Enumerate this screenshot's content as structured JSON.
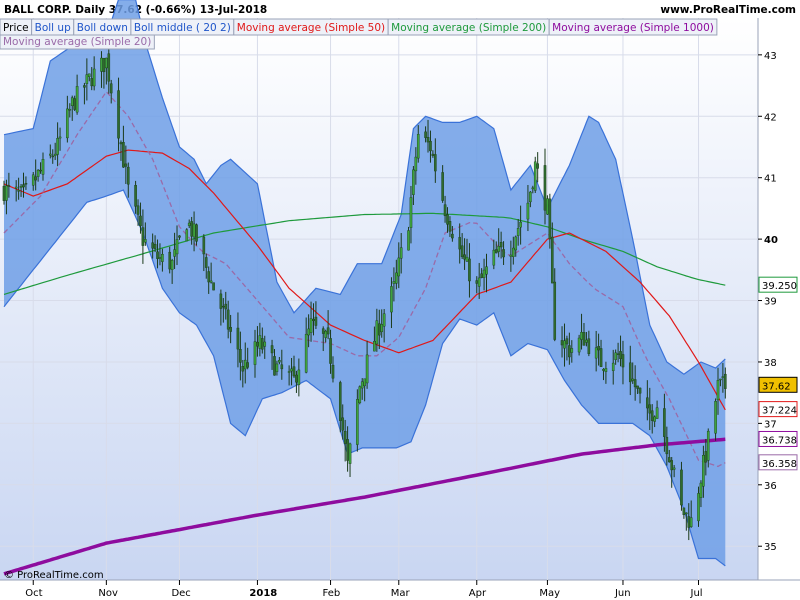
{
  "header": {
    "title": "BALL CORP.   Daily   37.62 (-0.66%)   13-Jul-2018",
    "website": "www.ProRealTime.com",
    "copyright": "© ProRealTime.com"
  },
  "colors": {
    "background": "#ffffff",
    "plot_background_top": "#ffffff",
    "plot_background_bottom": "#c9d6f2",
    "band_fill": "#6f9fe6",
    "band_line": "#3a72d8",
    "ma50": "#e01818",
    "ma200": "#1e9a3c",
    "ma1000": "#8e0c9e",
    "ma20": "#9a6aa8",
    "candle_up": "#3ea23e",
    "candle_down": "#2f6b2f",
    "wick": "#1a3a1a",
    "grid": "#d8dcea"
  },
  "chart_data": {
    "type": "candlestick",
    "symbol": "BALL CORP.",
    "interval": "Daily",
    "last_price": 37.62,
    "change_pct": "-0.66%",
    "date": "13-Jul-2018",
    "legend": [
      {
        "label": "Price",
        "color": "#000000"
      },
      {
        "label": "Boll up",
        "color": "#1f55c9"
      },
      {
        "label": "Boll down",
        "color": "#1f55c9"
      },
      {
        "label": "Boll middle ( 20 2)",
        "color": "#1f55c9"
      },
      {
        "label": "Moving average (Simple 50)",
        "color": "#e01818"
      },
      {
        "label": "Moving average (Simple 200)",
        "color": "#1e9a3c"
      },
      {
        "label": "Moving average (Simple 1000)",
        "color": "#8e0c9e"
      },
      {
        "label": "Moving average (Simple 20)",
        "color": "#9a6aa8"
      }
    ],
    "y_ticks": [
      35,
      36,
      37,
      38,
      39,
      40,
      41,
      42,
      43
    ],
    "y_ticks_bold": [
      40
    ],
    "ylim": [
      34.45,
      43.6
    ],
    "x_ticks": [
      {
        "label": "Oct",
        "bold": false
      },
      {
        "label": "Nov",
        "bold": false
      },
      {
        "label": "Dec",
        "bold": false
      },
      {
        "label": "2018",
        "bold": true
      },
      {
        "label": "Feb",
        "bold": false
      },
      {
        "label": "Mar",
        "bold": false
      },
      {
        "label": "Apr",
        "bold": false
      },
      {
        "label": "May",
        "bold": false
      },
      {
        "label": "Jun",
        "bold": false
      },
      {
        "label": "Jul",
        "bold": false
      }
    ],
    "x_tick_dates": [
      "2017-10-02",
      "2017-11-01",
      "2017-12-01",
      "2018-01-02",
      "2018-02-01",
      "2018-03-01",
      "2018-04-02",
      "2018-05-01",
      "2018-06-01",
      "2018-07-02"
    ],
    "start_date": "2017-09-20",
    "end_date": "2018-07-13",
    "x_axis_end_date": "2018-07-26",
    "price_labels": [
      {
        "text": "39.250",
        "value": 39.25,
        "color": "#1e9a3c",
        "fill": "#ffffff"
      },
      {
        "text": "37.62",
        "value": 37.62,
        "color": "#000000",
        "fill": "#f0c000"
      },
      {
        "text": "37.224",
        "value": 37.224,
        "color": "#e01818",
        "fill": "#ffffff"
      },
      {
        "text": "36.738",
        "value": 36.738,
        "color": "#8e0c9e",
        "fill": "#ffffff"
      },
      {
        "text": "36.358",
        "value": 36.358,
        "color": "#9a6aa8",
        "fill": "#ffffff"
      }
    ],
    "price_anchors": [
      [
        "2017-09-20",
        40.8
      ],
      [
        "2017-09-28",
        40.7
      ],
      [
        "2017-10-05",
        41.1
      ],
      [
        "2017-10-12",
        41.5
      ],
      [
        "2017-10-18",
        42.2
      ],
      [
        "2017-10-25",
        42.6
      ],
      [
        "2017-11-01",
        42.9
      ],
      [
        "2017-11-06",
        41.8
      ],
      [
        "2017-11-10",
        40.8
      ],
      [
        "2017-11-16",
        40.0
      ],
      [
        "2017-11-22",
        39.7
      ],
      [
        "2017-11-28",
        39.6
      ],
      [
        "2017-12-04",
        40.3
      ],
      [
        "2017-12-08",
        40.0
      ],
      [
        "2017-12-14",
        39.3
      ],
      [
        "2017-12-20",
        38.7
      ],
      [
        "2017-12-27",
        37.9
      ],
      [
        "2018-01-03",
        38.3
      ],
      [
        "2018-01-10",
        37.9
      ],
      [
        "2018-01-17",
        37.7
      ],
      [
        "2018-01-24",
        38.6
      ],
      [
        "2018-01-31",
        38.3
      ],
      [
        "2018-02-05",
        37.2
      ],
      [
        "2018-02-08",
        36.3
      ],
      [
        "2018-02-13",
        37.6
      ],
      [
        "2018-02-20",
        38.5
      ],
      [
        "2018-02-27",
        39.2
      ],
      [
        "2018-03-05",
        40.3
      ],
      [
        "2018-03-09",
        41.7
      ],
      [
        "2018-03-14",
        41.5
      ],
      [
        "2018-03-20",
        40.5
      ],
      [
        "2018-03-26",
        39.8
      ],
      [
        "2018-04-02",
        39.2
      ],
      [
        "2018-04-09",
        39.7
      ],
      [
        "2018-04-16",
        39.9
      ],
      [
        "2018-04-23",
        40.6
      ],
      [
        "2018-04-26",
        41.2
      ],
      [
        "2018-05-01",
        40.5
      ],
      [
        "2018-05-04",
        38.5
      ],
      [
        "2018-05-10",
        38.2
      ],
      [
        "2018-05-16",
        38.4
      ],
      [
        "2018-05-23",
        38.0
      ],
      [
        "2018-05-30",
        38.1
      ],
      [
        "2018-06-05",
        37.7
      ],
      [
        "2018-06-11",
        37.1
      ],
      [
        "2018-06-15",
        37.3
      ],
      [
        "2018-06-20",
        36.5
      ],
      [
        "2018-06-25",
        35.6
      ],
      [
        "2018-06-29",
        35.4
      ],
      [
        "2018-07-05",
        36.5
      ],
      [
        "2018-07-10",
        37.6
      ],
      [
        "2018-07-13",
        37.6
      ]
    ],
    "boll_up_anchors": [
      [
        "2017-09-20",
        41.7
      ],
      [
        "2017-10-02",
        41.8
      ],
      [
        "2017-10-09",
        42.9
      ],
      [
        "2017-10-20",
        43.2
      ],
      [
        "2017-11-01",
        43.3
      ],
      [
        "2017-11-06",
        43.9
      ],
      [
        "2017-11-13",
        43.9
      ],
      [
        "2017-11-17",
        43.2
      ],
      [
        "2017-11-24",
        42.3
      ],
      [
        "2017-12-01",
        41.5
      ],
      [
        "2017-12-07",
        41.3
      ],
      [
        "2017-12-12",
        40.9
      ],
      [
        "2017-12-18",
        41.2
      ],
      [
        "2017-12-22",
        41.3
      ],
      [
        "2018-01-02",
        40.9
      ],
      [
        "2018-01-10",
        39.3
      ],
      [
        "2018-01-17",
        38.8
      ],
      [
        "2018-01-26",
        39.2
      ],
      [
        "2018-02-05",
        39.1
      ],
      [
        "2018-02-12",
        39.6
      ],
      [
        "2018-02-22",
        39.6
      ],
      [
        "2018-03-02",
        40.4
      ],
      [
        "2018-03-07",
        41.8
      ],
      [
        "2018-03-12",
        42.0
      ],
      [
        "2018-03-19",
        41.9
      ],
      [
        "2018-03-26",
        41.9
      ],
      [
        "2018-04-02",
        42.0
      ],
      [
        "2018-04-09",
        41.8
      ],
      [
        "2018-04-16",
        40.8
      ],
      [
        "2018-04-24",
        41.2
      ],
      [
        "2018-05-01",
        40.5
      ],
      [
        "2018-05-10",
        41.2
      ],
      [
        "2018-05-18",
        42.0
      ],
      [
        "2018-05-22",
        41.9
      ],
      [
        "2018-05-29",
        41.3
      ],
      [
        "2018-06-05",
        40.0
      ],
      [
        "2018-06-12",
        38.6
      ],
      [
        "2018-06-19",
        38.0
      ],
      [
        "2018-06-26",
        37.8
      ],
      [
        "2018-07-03",
        38.0
      ],
      [
        "2018-07-09",
        37.9
      ],
      [
        "2018-07-13",
        38.05
      ]
    ],
    "boll_down_anchors": [
      [
        "2017-09-20",
        38.9
      ],
      [
        "2017-10-02",
        39.5
      ],
      [
        "2017-10-12",
        40.0
      ],
      [
        "2017-10-24",
        40.6
      ],
      [
        "2017-11-01",
        40.7
      ],
      [
        "2017-11-08",
        40.8
      ],
      [
        "2017-11-16",
        40.1
      ],
      [
        "2017-11-24",
        39.2
      ],
      [
        "2017-12-01",
        38.8
      ],
      [
        "2017-12-08",
        38.6
      ],
      [
        "2017-12-15",
        38.1
      ],
      [
        "2017-12-22",
        37.0
      ],
      [
        "2017-12-28",
        36.8
      ],
      [
        "2018-01-04",
        37.4
      ],
      [
        "2018-01-12",
        37.5
      ],
      [
        "2018-01-22",
        37.7
      ],
      [
        "2018-02-01",
        37.4
      ],
      [
        "2018-02-08",
        36.5
      ],
      [
        "2018-02-14",
        36.6
      ],
      [
        "2018-02-21",
        36.6
      ],
      [
        "2018-02-28",
        36.6
      ],
      [
        "2018-03-06",
        36.7
      ],
      [
        "2018-03-12",
        37.3
      ],
      [
        "2018-03-19",
        38.3
      ],
      [
        "2018-03-26",
        38.7
      ],
      [
        "2018-04-02",
        38.6
      ],
      [
        "2018-04-09",
        38.8
      ],
      [
        "2018-04-16",
        38.1
      ],
      [
        "2018-04-23",
        38.3
      ],
      [
        "2018-05-01",
        38.2
      ],
      [
        "2018-05-08",
        37.7
      ],
      [
        "2018-05-15",
        37.3
      ],
      [
        "2018-05-22",
        37.0
      ],
      [
        "2018-05-29",
        37.0
      ],
      [
        "2018-06-05",
        37.0
      ],
      [
        "2018-06-12",
        36.8
      ],
      [
        "2018-06-19",
        36.3
      ],
      [
        "2018-06-26",
        35.6
      ],
      [
        "2018-07-02",
        34.8
      ],
      [
        "2018-07-09",
        34.8
      ],
      [
        "2018-07-13",
        34.68
      ]
    ],
    "ma20_anchors": [
      [
        "2017-09-20",
        40.1
      ],
      [
        "2017-10-05",
        40.7
      ],
      [
        "2017-10-20",
        41.7
      ],
      [
        "2017-11-01",
        42.4
      ],
      [
        "2017-11-10",
        42.0
      ],
      [
        "2017-11-20",
        41.3
      ],
      [
        "2017-12-01",
        40.2
      ],
      [
        "2017-12-10",
        39.8
      ],
      [
        "2017-12-20",
        39.6
      ],
      [
        "2018-01-02",
        39.0
      ],
      [
        "2018-01-15",
        38.4
      ],
      [
        "2018-02-01",
        38.3
      ],
      [
        "2018-02-12",
        38.1
      ],
      [
        "2018-02-20",
        38.1
      ],
      [
        "2018-03-01",
        38.4
      ],
      [
        "2018-03-12",
        39.2
      ],
      [
        "2018-03-20",
        40.1
      ],
      [
        "2018-04-01",
        40.3
      ],
      [
        "2018-04-15",
        39.7
      ],
      [
        "2018-05-01",
        40.1
      ],
      [
        "2018-05-10",
        39.6
      ],
      [
        "2018-05-20",
        39.2
      ],
      [
        "2018-06-01",
        38.9
      ],
      [
        "2018-06-10",
        38.1
      ],
      [
        "2018-06-20",
        37.4
      ],
      [
        "2018-07-02",
        36.4
      ],
      [
        "2018-07-10",
        36.3
      ],
      [
        "2018-07-13",
        36.36
      ]
    ],
    "ma50_anchors": [
      [
        "2017-09-20",
        40.9
      ],
      [
        "2017-10-02",
        40.7
      ],
      [
        "2017-10-16",
        40.9
      ],
      [
        "2017-11-01",
        41.35
      ],
      [
        "2017-11-10",
        41.45
      ],
      [
        "2017-11-24",
        41.4
      ],
      [
        "2017-12-05",
        41.15
      ],
      [
        "2017-12-15",
        40.75
      ],
      [
        "2018-01-02",
        39.9
      ],
      [
        "2018-01-15",
        39.2
      ],
      [
        "2018-02-01",
        38.6
      ],
      [
        "2018-02-15",
        38.35
      ],
      [
        "2018-03-01",
        38.15
      ],
      [
        "2018-03-15",
        38.35
      ],
      [
        "2018-04-02",
        39.1
      ],
      [
        "2018-04-16",
        39.3
      ],
      [
        "2018-05-01",
        40.0
      ],
      [
        "2018-05-10",
        40.1
      ],
      [
        "2018-05-25",
        39.8
      ],
      [
        "2018-06-08",
        39.3
      ],
      [
        "2018-06-20",
        38.75
      ],
      [
        "2018-07-02",
        38.0
      ],
      [
        "2018-07-13",
        37.22
      ]
    ],
    "ma200_anchors": [
      [
        "2017-09-20",
        39.1
      ],
      [
        "2017-10-15",
        39.4
      ],
      [
        "2017-11-15",
        39.75
      ],
      [
        "2017-12-15",
        40.1
      ],
      [
        "2018-01-15",
        40.3
      ],
      [
        "2018-02-15",
        40.4
      ],
      [
        "2018-03-15",
        40.42
      ],
      [
        "2018-04-15",
        40.35
      ],
      [
        "2018-05-01",
        40.2
      ],
      [
        "2018-05-15",
        40.0
      ],
      [
        "2018-06-01",
        39.8
      ],
      [
        "2018-06-15",
        39.55
      ],
      [
        "2018-07-01",
        39.35
      ],
      [
        "2018-07-13",
        39.25
      ]
    ],
    "ma1000_anchors": [
      [
        "2017-09-20",
        34.55
      ],
      [
        "2017-11-01",
        35.05
      ],
      [
        "2018-01-01",
        35.5
      ],
      [
        "2018-02-15",
        35.8
      ],
      [
        "2018-04-01",
        36.15
      ],
      [
        "2018-05-15",
        36.5
      ],
      [
        "2018-06-15",
        36.65
      ],
      [
        "2018-07-13",
        36.74
      ]
    ]
  }
}
